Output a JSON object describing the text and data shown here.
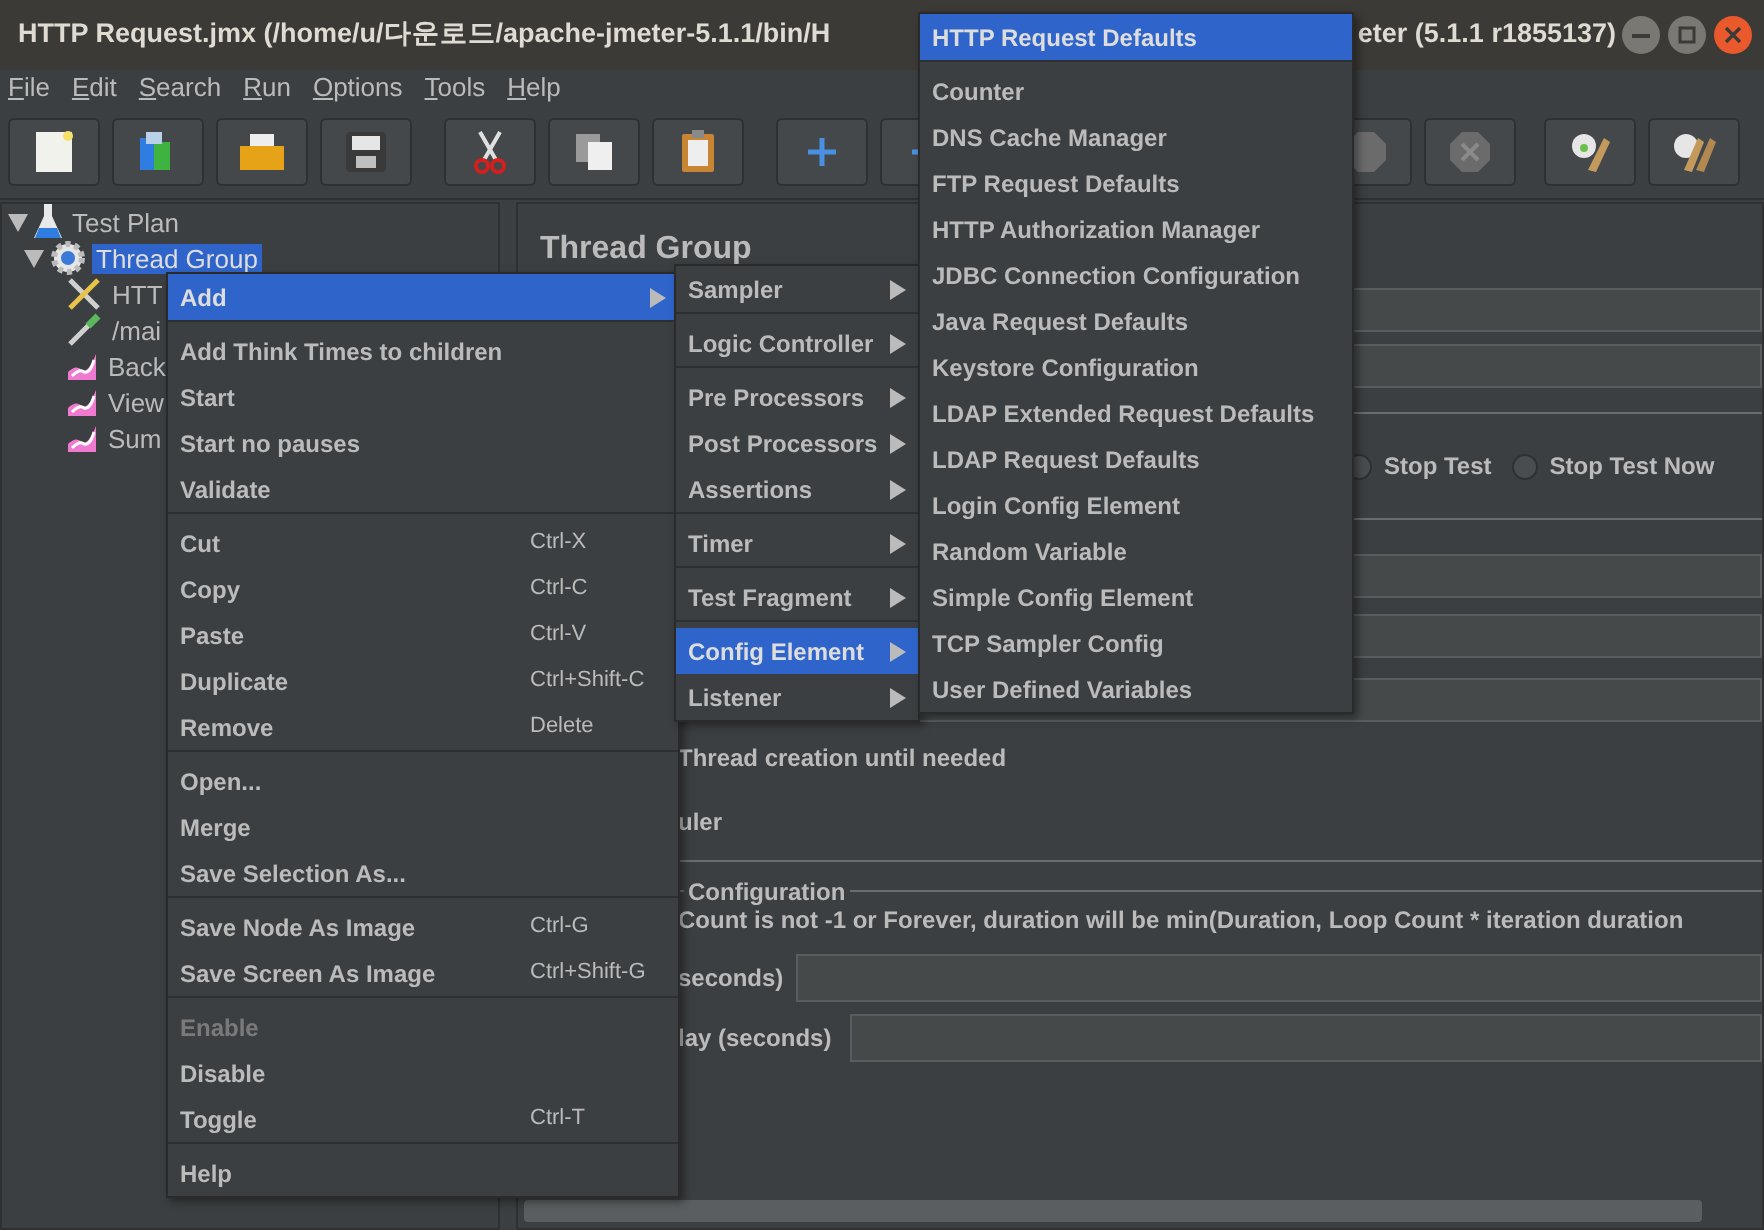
{
  "window": {
    "title_left": "HTTP Request.jmx (/home/u/다운로드/apache-jmeter-5.1.1/bin/H",
    "title_right": "eter (5.1.1 r1855137)"
  },
  "menu_bar": [
    "File",
    "Edit",
    "Search",
    "Run",
    "Options",
    "Tools",
    "Help"
  ],
  "tree": [
    {
      "label": "Test Plan",
      "kind": "plan",
      "expanded": true,
      "selected": false,
      "children": [
        {
          "label": "Thread Group",
          "kind": "group",
          "expanded": true,
          "selected": true,
          "children": [
            {
              "label": "HTT",
              "kind": "sampler",
              "selected": false
            },
            {
              "label": "/mai",
              "kind": "preprocessor",
              "selected": false
            },
            {
              "label": "Back",
              "kind": "listener",
              "selected": false
            },
            {
              "label": "View",
              "kind": "listener",
              "selected": false
            },
            {
              "label": "Sum",
              "kind": "listener",
              "selected": false
            }
          ]
        }
      ]
    }
  ],
  "thread_group": {
    "title": "Thread Group",
    "radio_options": [
      {
        "label": "Stop Test",
        "selected": false
      },
      {
        "label": "Stop Test Now",
        "selected": false
      }
    ],
    "delay_label": "Thread creation until needed",
    "scheduler_label": "uler",
    "section_title": "Configuration",
    "note": "Count is not -1 or Forever, duration will be min(Duration, Loop Count * iteration duration",
    "field_labels": [
      "seconds)",
      "lay (seconds)"
    ]
  },
  "context_menu": {
    "groups": [
      [
        {
          "label": "Add",
          "submenu": true,
          "selected": true,
          "disabled": false
        }
      ],
      [
        {
          "label": "Add Think Times to children",
          "submenu": false,
          "selected": false,
          "disabled": false
        },
        {
          "label": "Start",
          "submenu": false,
          "selected": false,
          "disabled": false
        },
        {
          "label": "Start no pauses",
          "submenu": false,
          "selected": false,
          "disabled": false
        },
        {
          "label": "Validate",
          "submenu": false,
          "selected": false,
          "disabled": false
        }
      ],
      [
        {
          "label": "Cut",
          "shortcut": "Ctrl-X",
          "submenu": false,
          "selected": false,
          "disabled": false
        },
        {
          "label": "Copy",
          "shortcut": "Ctrl-C",
          "submenu": false,
          "selected": false,
          "disabled": false
        },
        {
          "label": "Paste",
          "shortcut": "Ctrl-V",
          "submenu": false,
          "selected": false,
          "disabled": false
        },
        {
          "label": "Duplicate",
          "shortcut": "Ctrl+Shift-C",
          "submenu": false,
          "selected": false,
          "disabled": false
        },
        {
          "label": "Remove",
          "shortcut": "Delete",
          "submenu": false,
          "selected": false,
          "disabled": false
        }
      ],
      [
        {
          "label": "Open...",
          "submenu": false,
          "selected": false,
          "disabled": false
        },
        {
          "label": "Merge",
          "submenu": false,
          "selected": false,
          "disabled": false
        },
        {
          "label": "Save Selection As...",
          "submenu": false,
          "selected": false,
          "disabled": false
        }
      ],
      [
        {
          "label": "Save Node As Image",
          "shortcut": "Ctrl-G",
          "submenu": false,
          "selected": false,
          "disabled": false
        },
        {
          "label": "Save Screen As Image",
          "shortcut": "Ctrl+Shift-G",
          "submenu": false,
          "selected": false,
          "disabled": false
        }
      ],
      [
        {
          "label": "Enable",
          "submenu": false,
          "selected": false,
          "disabled": true
        },
        {
          "label": "Disable",
          "submenu": false,
          "selected": false,
          "disabled": false
        },
        {
          "label": "Toggle",
          "shortcut": "Ctrl-T",
          "submenu": false,
          "selected": false,
          "disabled": false
        }
      ],
      [
        {
          "label": "Help",
          "submenu": false,
          "selected": false,
          "disabled": false
        }
      ]
    ]
  },
  "add_submenu": {
    "groups": [
      [
        {
          "label": "Sampler",
          "selected": false
        }
      ],
      [
        {
          "label": "Logic Controller",
          "selected": false
        }
      ],
      [
        {
          "label": "Pre Processors",
          "selected": false
        },
        {
          "label": "Post Processors",
          "selected": false
        },
        {
          "label": "Assertions",
          "selected": false
        }
      ],
      [
        {
          "label": "Timer",
          "selected": false
        }
      ],
      [
        {
          "label": "Test Fragment",
          "selected": false
        }
      ],
      [
        {
          "label": "Config Element",
          "selected": true
        },
        {
          "label": "Listener",
          "selected": false
        }
      ]
    ]
  },
  "config_submenu": {
    "groups": [
      [
        {
          "label": "HTTP Request Defaults",
          "selected": true
        }
      ],
      [
        {
          "label": "Counter",
          "selected": false
        },
        {
          "label": "DNS Cache Manager",
          "selected": false
        },
        {
          "label": "FTP Request Defaults",
          "selected": false
        },
        {
          "label": "HTTP Authorization Manager",
          "selected": false
        },
        {
          "label": "JDBC Connection Configuration",
          "selected": false
        },
        {
          "label": "Java Request Defaults",
          "selected": false
        },
        {
          "label": "Keystore Configuration",
          "selected": false
        },
        {
          "label": "LDAP Extended Request Defaults",
          "selected": false
        },
        {
          "label": "LDAP Request Defaults",
          "selected": false
        },
        {
          "label": "Login Config Element",
          "selected": false
        },
        {
          "label": "Random Variable",
          "selected": false
        },
        {
          "label": "Simple Config Element",
          "selected": false
        },
        {
          "label": "TCP Sampler Config",
          "selected": false
        },
        {
          "label": "User Defined Variables",
          "selected": false
        }
      ]
    ]
  }
}
